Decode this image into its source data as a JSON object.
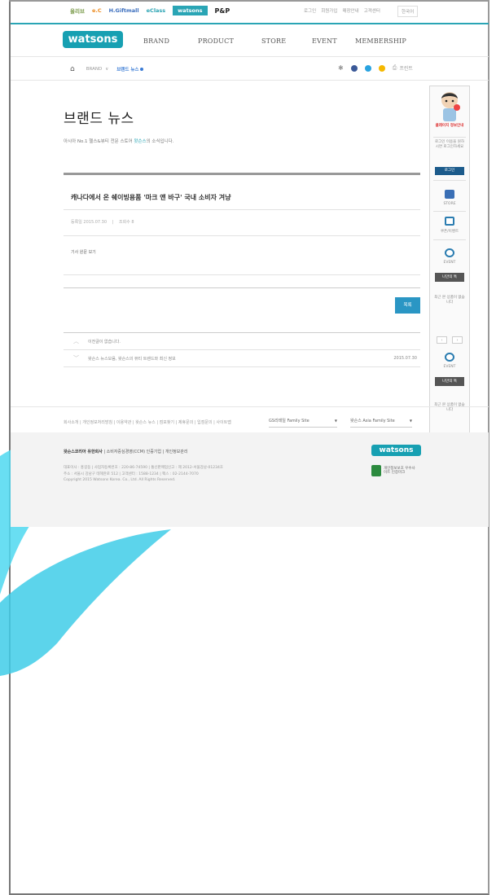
{
  "family_sites": [
    {
      "label": "올리브",
      "cls": "f1"
    },
    {
      "label": "e.C",
      "cls": "f2"
    },
    {
      "label": "H.Giftmall",
      "cls": "f3"
    },
    {
      "label": "eClass",
      "cls": "f4"
    },
    {
      "label": "watsons",
      "cls": "active"
    },
    {
      "label": "P&P",
      "cls": "f6"
    }
  ],
  "utility_links": [
    "로그인",
    "회원가입",
    "매장안내",
    "고객센터"
  ],
  "language": "한국어",
  "logo": "watsons",
  "gnb": [
    "BRAND",
    "PRODUCT",
    "STORE",
    "EVENT",
    "MEMBERSHIP"
  ],
  "breadcrumb": {
    "home": "⌂",
    "level1": "BRAND",
    "chevron": "∨",
    "current": "브랜드 뉴스",
    "print_label": "프린트"
  },
  "page": {
    "title": "브랜드 뉴스",
    "subtitle_prefix": "아시아 No.1 헬스&뷰티 전문 스토어 ",
    "subtitle_brand": "왓슨스",
    "subtitle_suffix": "의 소식입니다."
  },
  "article": {
    "title": "캐나다에서 온 쉐이빙용품 '마크 앤 바구' 국내 소비자 겨냥",
    "date_label": "등록일",
    "date": "2015.07.30",
    "views_label": "조회수",
    "views": "8",
    "body": "기사 원문 보기"
  },
  "list_button": "목록",
  "prev_next": {
    "prev_text": "이전글이 없습니다.",
    "next_text": "왓슨스 뉴스모음, 왓슨스의 뷰티 트렌드와 최신 정보",
    "next_date": "2015.07.30"
  },
  "quick_menu": {
    "heading": "클레이지 정보안내",
    "login_msg": "로그인 이용을 원하시면 로그인하세요",
    "login_button": "로그인",
    "store_label": "STORE",
    "coupon_label": "쿠폰/이벤트",
    "event_label": "EVENT",
    "recent_label": "나만의 톡",
    "recent_empty": "최근 본 상품이 없습니다",
    "event_label_2": "EVENT",
    "recent_label_2": "나만의 톡",
    "recent_empty_2": "최근 본 상품이 없습니다",
    "top_label": "TOP"
  },
  "footer": {
    "links": "회사소개 | 개인정보처리방침 | 이용약관 | 왓슨스 뉴스 | 점포찾기 | 제휴문의 | 입점문의 | 사이트맵",
    "family_select_1": "GS리테일 Family Site",
    "family_select_2": "왓슨스 Asia Family Site",
    "company_name": "왓슨스코리아 유한회사",
    "company_links": "| 소비자중심경영(CCM) 인증기업 | 개인정보관리",
    "info_1": "대표이사 : 홍길동 | 사업자등록번호 : 220-86-74590 | 통신판매업신고 : 제 2012-서울강남-01234호",
    "info_2": "주소 : 서울시 강남구 테헤란로 512 | 고객센터 : 1588-1234 | 팩스 : 02-2144-7070",
    "info_3": "Copyright 2015 Watsons Korea. Co., Ltd. All Rights Reserved.",
    "logo": "watsons",
    "cert": "개인정보보호 우수사이트 인증마크"
  },
  "colors": {
    "brand": "#17a0b2",
    "accent": "#2aa5b5",
    "link": "#3a7bd5",
    "button": "#2a96c4",
    "badge": "#1c5b8b"
  }
}
